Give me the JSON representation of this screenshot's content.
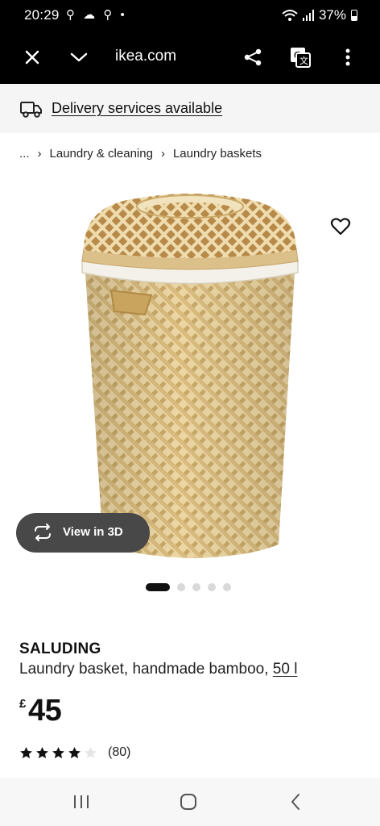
{
  "status": {
    "time": "20:29",
    "notification_icons": "⚲ ☁ ⚲ •",
    "battery": "37%"
  },
  "browser": {
    "url": "ikea.com",
    "icons": [
      "close-icon",
      "chevron-down-icon",
      "share-icon",
      "translate-icon",
      "more-vert-icon"
    ]
  },
  "delivery": {
    "label": "Delivery services available",
    "icon": "truck-icon"
  },
  "breadcrumb": {
    "ellipsis": "...",
    "items": [
      "Laundry & cleaning",
      "Laundry baskets"
    ],
    "separator": "›"
  },
  "gallery": {
    "view3d_label": "View in 3D",
    "image_count": 5,
    "active_index": 0
  },
  "product": {
    "name": "SALUDING",
    "description": "Laundry basket, handmade bamboo, ",
    "size": "50 l",
    "currency": "£",
    "price": "45",
    "rating": 4,
    "rating_max": 5,
    "review_count": "(80)"
  },
  "colors": {
    "bamboo": "#E8D2A0",
    "bamboo_dark": "#CDAF6E",
    "accent_black": "#111111",
    "view3d_bg": "#484848"
  }
}
